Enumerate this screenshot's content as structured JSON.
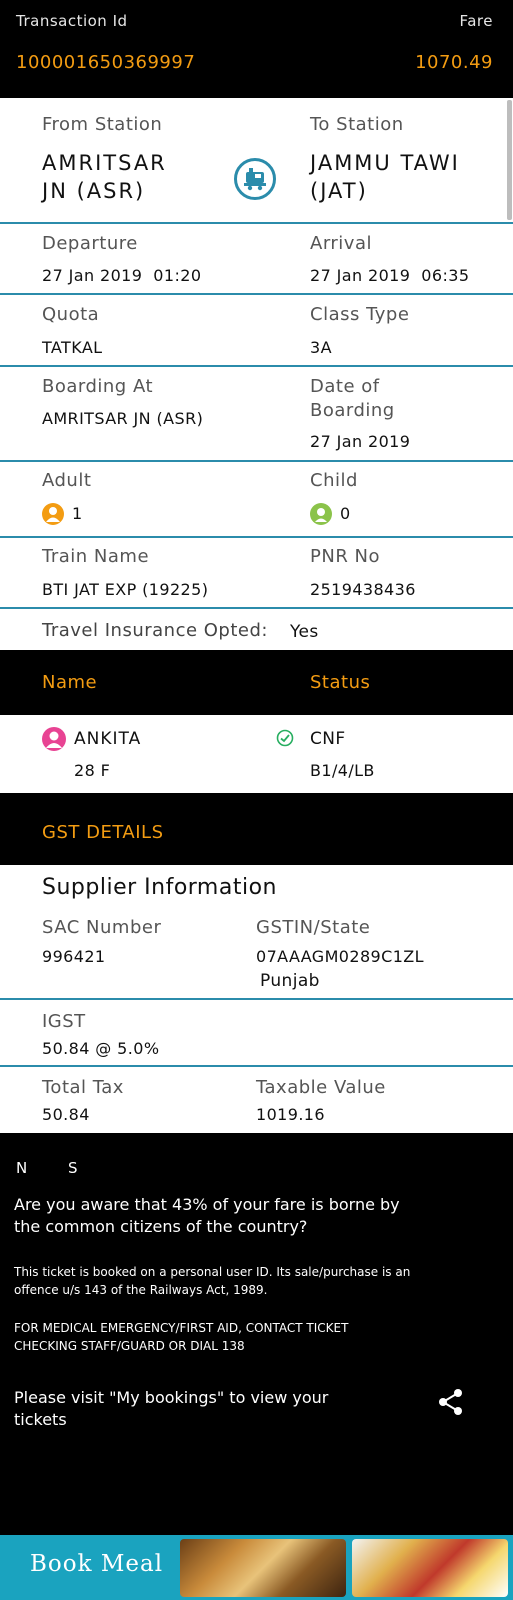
{
  "transaction": {
    "id_label": "Transaction Id",
    "id_value": "100001650369997",
    "fare_label": "Fare",
    "fare_value": "1070.49"
  },
  "journey": {
    "from_label": "From Station",
    "from_line1": "AMRITSAR",
    "from_line2": "JN (ASR)",
    "to_label": "To Station",
    "to_line1": "JAMMU TAWI",
    "to_line2": "(JAT)",
    "departure_label": "Departure",
    "departure_value": "27 Jan 2019  01:20",
    "arrival_label": "Arrival",
    "arrival_value": "27 Jan 2019  06:35",
    "quota_label": "Quota",
    "quota_value": "TATKAL",
    "class_label": "Class Type",
    "class_value": "3A",
    "boarding_label": "Boarding At",
    "boarding_value": "AMRITSAR JN (ASR)",
    "doboarding_label_1": "Date of",
    "doboarding_label_2": "Boarding",
    "doboarding_value": "27 Jan 2019",
    "adult_label": "Adult",
    "adult_value": "1",
    "child_label": "Child",
    "child_value": "0",
    "train_label": "Train Name",
    "train_value": "BTI JAT EXP (19225)",
    "pnr_label": "PNR No",
    "pnr_value": "2519438436",
    "insurance_label": "Travel Insurance Opted:",
    "insurance_value": "Yes"
  },
  "passengers": {
    "name_header": "Name",
    "status_header": "Status",
    "rows": [
      {
        "name": "ANKITA",
        "age_gender": "28 F",
        "status": "CNF",
        "berth": "B1/4/LB"
      }
    ]
  },
  "gst": {
    "header": "GST DETAILS",
    "supplier_title": "Supplier Information",
    "sac_label": "SAC Number",
    "sac_value": "996421",
    "gstin_label": "GSTIN/State",
    "gstin_value": "07AAAGM0289C1ZL",
    "state_value": "Punjab",
    "igst_label": "IGST",
    "igst_value": "50.84 @ 5.0%",
    "total_tax_label": "Total Tax",
    "total_tax_value": "50.84",
    "taxable_label": "Taxable Value",
    "taxable_value": "1019.16"
  },
  "footer": {
    "ns_n": "N",
    "ns_s": "S",
    "aware_line1": "Are you aware that 43% of your fare is borne by",
    "aware_line2": "the common citizens of the country?",
    "note_line1": "This ticket is booked on a personal user ID. Its sale/purchase is an",
    "note_line2": "offence u/s 143 of the Railways Act, 1989.",
    "emergency_line1": "FOR MEDICAL EMERGENCY/FIRST AID, CONTACT TICKET",
    "emergency_line2": "CHECKING STAFF/GUARD OR DIAL 138",
    "visit_line1": "Please visit \"My bookings\" to view your",
    "visit_line2": "tickets",
    "book_meal": "Book Meal"
  },
  "colors": {
    "accent_orange": "#f39c12",
    "divider_teal": "#2b8cab",
    "meal_bar": "#1aa3bf"
  },
  "icons": [
    "train-icon",
    "adult-icon",
    "child-icon",
    "passenger-icon",
    "check-circle-icon",
    "share-icon"
  ]
}
